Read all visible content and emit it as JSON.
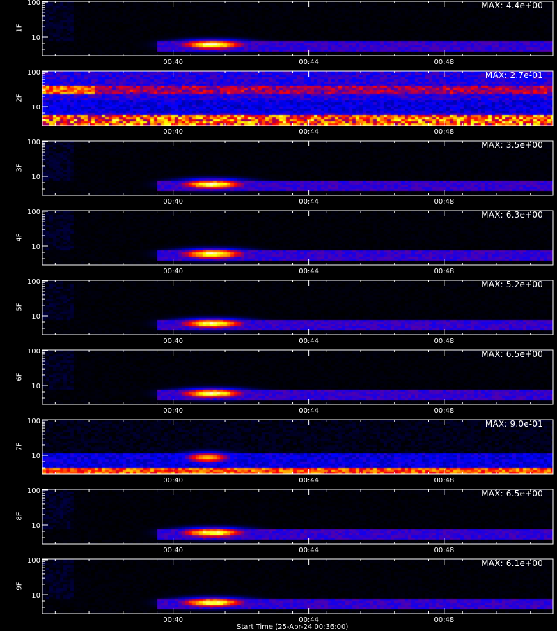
{
  "chart_data": {
    "type": "heatmap",
    "x_ticks": [
      "00:40",
      "00:44",
      "00:48"
    ],
    "y_ticks": [
      "100",
      "10"
    ],
    "x_axis_title": "Start Time (25-Apr-24 00:36:00)",
    "colormap": [
      "#000000",
      "#0000ff",
      "#ff0000",
      "#ffff00",
      "#ffffff"
    ],
    "panels": [
      {
        "ylabel": "1F",
        "max_text": "MAX: 4.4e+00",
        "pattern": "quiet"
      },
      {
        "ylabel": "2F",
        "max_text": "MAX: 2.7e-01",
        "pattern": "noisy"
      },
      {
        "ylabel": "3F",
        "max_text": "MAX: 3.5e+00",
        "pattern": "quiet"
      },
      {
        "ylabel": "4F",
        "max_text": "MAX: 6.3e+00",
        "pattern": "quiet"
      },
      {
        "ylabel": "5F",
        "max_text": "MAX: 5.2e+00",
        "pattern": "quiet"
      },
      {
        "ylabel": "6F",
        "max_text": "MAX: 6.5e+00",
        "pattern": "quiet"
      },
      {
        "ylabel": "7F",
        "max_text": "MAX: 9.0e-01",
        "pattern": "low-band"
      },
      {
        "ylabel": "8F",
        "max_text": "MAX: 6.5e+00",
        "pattern": "quiet"
      },
      {
        "ylabel": "9F",
        "max_text": "MAX: 6.1e+00",
        "pattern": "quiet"
      }
    ]
  }
}
